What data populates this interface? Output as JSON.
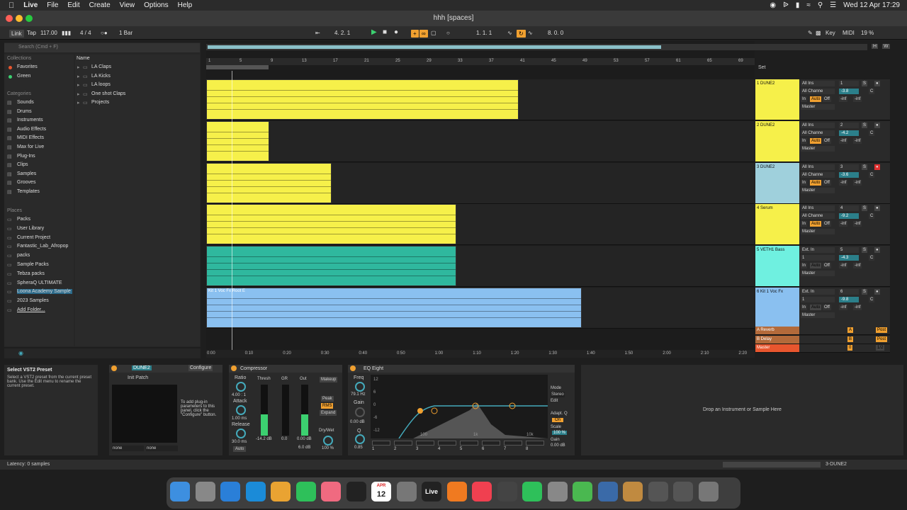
{
  "menubar": {
    "app": "Live",
    "items": [
      "File",
      "Edit",
      "Create",
      "View",
      "Options",
      "Help"
    ],
    "datetime": "Wed 12 Apr  17:29"
  },
  "window": {
    "title": "hhh  [spaces]"
  },
  "transport": {
    "link": "Link",
    "tap": "Tap",
    "tempo": "117.00",
    "signature": "4 / 4",
    "quantize": "1 Bar",
    "position": "4.  2.  1",
    "loop_start": "1.  1.  1",
    "loop_length": "8.  0.  0",
    "key": "Key",
    "midi": "MIDI",
    "cpu": "19 %"
  },
  "browser": {
    "search_placeholder": "Search (Cmd + F)",
    "collections_label": "Collections",
    "collections": [
      "Favorites",
      "Green"
    ],
    "collection_colors": [
      "#e8562e",
      "#3cd070"
    ],
    "categories_label": "Categories",
    "categories": [
      "Sounds",
      "Drums",
      "Instruments",
      "Audio Effects",
      "MIDI Effects",
      "Max for Live",
      "Plug-Ins",
      "Clips",
      "Samples",
      "Grooves",
      "Templates"
    ],
    "places_label": "Places",
    "places": [
      "Packs",
      "User Library",
      "Current Project",
      "Fantastic_Lab_Afropop",
      "packs",
      "Sample Packs",
      "Tebza packs",
      "SpheraQ ULTIMATE",
      "Loona Academy Sample",
      "2023 Samples",
      "Add Folder..."
    ],
    "name_header": "Name",
    "folders": [
      "LA Claps",
      "LA Kicks",
      "LA loops",
      "One shot Claps",
      "Projects"
    ]
  },
  "ruler": {
    "marks": [
      "1",
      "5",
      "9",
      "13",
      "17",
      "21",
      "25",
      "29",
      "33",
      "37",
      "41",
      "45",
      "49",
      "53",
      "57",
      "61",
      "65",
      "69"
    ],
    "time_marks": [
      "0:00",
      "0:10",
      "0:20",
      "0:30",
      "0:40",
      "0:50",
      "1:00",
      "1:10",
      "1:20",
      "1:30",
      "1:40",
      "1:50",
      "2:00",
      "2:10",
      "2:20"
    ]
  },
  "set_label": "Set",
  "tracks": [
    {
      "name": "1 DUNE2",
      "input": "All Ins",
      "channel": "All Channe",
      "vol": "-3.8",
      "pan": "C",
      "auto": "Auto",
      "off": "Off",
      "in": "In",
      "out": "Master",
      "send1": "-inf",
      "send2": "-inf",
      "num": "1",
      "color": "#f6f04a"
    },
    {
      "name": "2 DUNE2",
      "input": "All Ins",
      "channel": "All Channe",
      "vol": "-4.2",
      "pan": "C",
      "auto": "Auto",
      "off": "Off",
      "in": "In",
      "out": "Master",
      "send1": "-inf",
      "send2": "-inf",
      "num": "2",
      "color": "#f6f04a"
    },
    {
      "name": "3 DUNE2",
      "input": "All Ins",
      "channel": "All Channe",
      "vol": "-3.6",
      "pan": "C",
      "auto": "Auto",
      "off": "Off",
      "in": "In",
      "out": "Master",
      "send1": "-inf",
      "send2": "-inf",
      "num": "3",
      "color": "#9fd0dc"
    },
    {
      "name": "4 Serum",
      "input": "All Ins",
      "channel": "All Channe",
      "vol": "-9.2",
      "pan": "C",
      "auto": "Auto",
      "off": "Off",
      "in": "In",
      "out": "Master",
      "send1": "-inf",
      "send2": "-inf",
      "num": "4",
      "color": "#f6f04a"
    },
    {
      "name": "5 VETH1 Bass",
      "input": "Ext. In",
      "channel": "1",
      "vol": "-4.3",
      "pan": "C",
      "auto": "Auto",
      "off": "Off",
      "in": "In",
      "out": "Master",
      "send1": "-inf",
      "send2": "-inf",
      "num": "5",
      "color": "#6ff0e0"
    },
    {
      "name": "6 Kit 1 Voc Fx",
      "input": "Ext. In",
      "channel": "1",
      "vol": "-9.8",
      "pan": "C",
      "auto": "Auto",
      "off": "Off",
      "in": "In",
      "out": "Master",
      "send1": "-inf",
      "send2": "-inf",
      "num": "6",
      "color": "#8ac0f0"
    }
  ],
  "returns": [
    {
      "name": "A Reverb",
      "letter": "A",
      "post": "Post"
    },
    {
      "name": "B Delay",
      "letter": "B",
      "post": "Post"
    },
    {
      "name": "Master",
      "letter": "0",
      "post": "1/2"
    }
  ],
  "voc_clip_label": "Kit 1 Voc Fx Root E",
  "info": {
    "title": "Select VST2 Preset",
    "body": "Select a VST2 preset from the current preset bank. Use the Edit menu to rename the current preset."
  },
  "devices": {
    "dune": {
      "name": "DUNE2",
      "configure": "Configure",
      "patch": "Init Patch",
      "hint": "To add plug-in parameters to this panel, click the \"Configure\" button.",
      "sel1": "none",
      "sel2": "none"
    },
    "comp": {
      "name": "Compressor",
      "ratio_label": "Ratio",
      "ratio": "4.00 : 1",
      "attack_label": "Attack",
      "attack": "1.00 ms",
      "release_label": "Release",
      "release": "30.0 ms",
      "auto": "Auto",
      "thresh_label": "Thresh",
      "gr_label": "GR",
      "out_label": "Out",
      "thresh_val": "-14.2 dB",
      "gr_val": "0.0",
      "out_val": "0.00 dB",
      "makeup": "Makeup",
      "peak": "Peak",
      "rms": "RMS",
      "expand": "Expand",
      "drywet": "Dry/Wet",
      "drywet_val": "100 %",
      "knee": "Knee",
      "knee_val": "6.0 dB"
    },
    "eq": {
      "name": "EQ Eight",
      "freq_label": "Freq",
      "freq": "79.1 Hz",
      "gain_label": "Gain",
      "gain": "0.00 dB",
      "q_label": "Q",
      "q": "0.85",
      "mode_label": "Mode",
      "mode": "Stereo",
      "edit": "Edit",
      "adapt": "Adapt. Q",
      "on": "On",
      "scale_label": "Scale",
      "scale": "100 %",
      "out_gain_label": "Gain",
      "out_gain": "0.00 dB",
      "db_ticks": [
        "12",
        "6",
        "0",
        "-6",
        "-12"
      ],
      "freq_ticks": [
        "100",
        "1k",
        "10k"
      ],
      "bands": [
        "1",
        "2",
        "3",
        "4",
        "5",
        "6",
        "7",
        "8"
      ]
    }
  },
  "dropzone": "Drop an Instrument or Sample Here",
  "status": {
    "latency": "Latency: 0 samples",
    "track": "3-DUNE2"
  },
  "dock": [
    "Finder",
    "Launchpad",
    "Safari",
    "Edge",
    "Chrome",
    "WhatsApp",
    "Photos",
    "TV",
    "Calendar",
    "Compressor",
    "Live",
    "FL Studio",
    "Music",
    "Final Cut",
    "Spotify",
    "Settings",
    "uTorrent",
    "QuickTime",
    "Guitar",
    "Files",
    "Files",
    "Trash"
  ],
  "calendar": {
    "month": "APR",
    "day": "12"
  }
}
